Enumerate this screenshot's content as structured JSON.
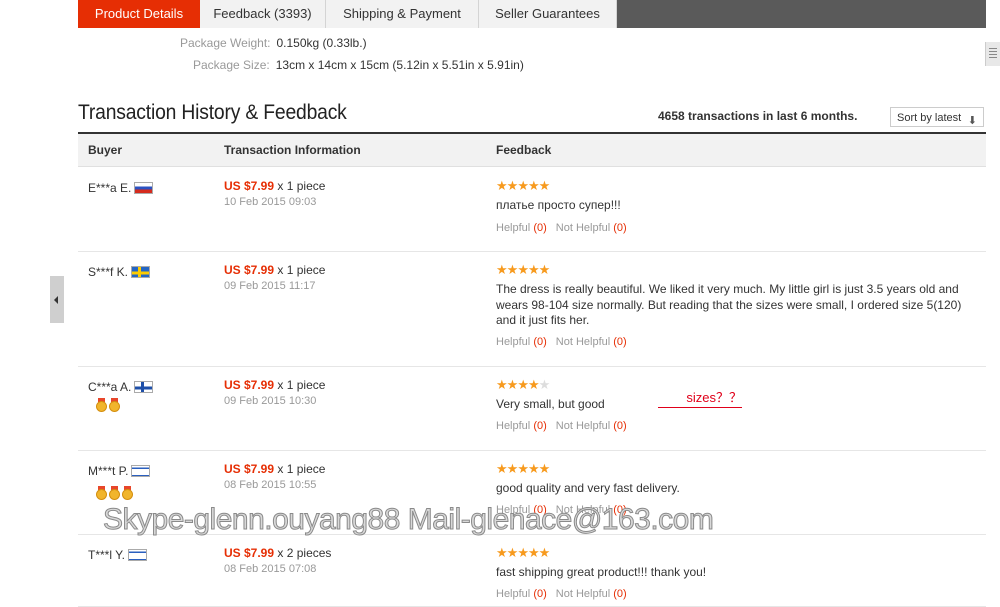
{
  "tabs": [
    {
      "label": "Product Details",
      "active": true
    },
    {
      "label": "Feedback (3393)",
      "active": false
    },
    {
      "label": "Shipping & Payment",
      "active": false
    },
    {
      "label": "Seller Guarantees",
      "active": false
    }
  ],
  "specs": {
    "weight_label": "Package Weight:",
    "weight_value": "0.150kg (0.33lb.)",
    "size_label": "Package Size:",
    "size_value": "13cm x 14cm x 15cm (5.12in x 5.51in x 5.91in)"
  },
  "section_title": "Transaction History & Feedback",
  "transactions_count": "4658 transactions in last 6 months.",
  "sort_label": "Sort by latest",
  "columns": {
    "buyer": "Buyer",
    "transaction": "Transaction Information",
    "feedback": "Feedback"
  },
  "helpful_label": "Helpful",
  "not_helpful_label": "Not Helpful",
  "colors": {
    "accent": "#e62e04",
    "star": "#f79a1e"
  },
  "rows": [
    {
      "buyer": "E***a E.",
      "flag": "ru",
      "medals": 0,
      "price": "US $7.99",
      "qty": " x 1 piece",
      "date": "10 Feb 2015 09:03",
      "stars": 5,
      "feedback": "платье просто супер!!!",
      "helpful": "(0)",
      "not_helpful": "(0)"
    },
    {
      "buyer": "S***f K.",
      "flag": "se",
      "medals": 0,
      "price": "US $7.99",
      "qty": " x 1 piece",
      "date": "09 Feb 2015 11:17",
      "stars": 5,
      "feedback": "The dress is really beautiful. We liked it very much. My little girl is just 3.5 years old and wears 98-104 size normally. But reading that the sizes were small, I ordered size 5(120) and it just fits her.",
      "helpful": "(0)",
      "not_helpful": "(0)"
    },
    {
      "buyer": "C***a A.",
      "flag": "fi",
      "medals": 2,
      "price": "US $7.99",
      "qty": " x 1 piece",
      "date": "09 Feb 2015 10:30",
      "stars": 4,
      "feedback": "Very small, but good",
      "helpful": "(0)",
      "not_helpful": "(0)"
    },
    {
      "buyer": "M***t P.",
      "flag": "il",
      "medals": 3,
      "price": "US $7.99",
      "qty": " x 1 piece",
      "date": "08 Feb 2015 10:55",
      "stars": 5,
      "feedback": "good quality and very fast delivery.",
      "helpful": "(0)",
      "not_helpful": "(0)"
    },
    {
      "buyer": "T***l Y.",
      "flag": "il",
      "medals": 0,
      "price": "US $7.99",
      "qty": " x 2 pieces",
      "date": "08 Feb 2015 07:08",
      "stars": 5,
      "feedback": "fast shipping great product!!! thank you!",
      "helpful": "(0)",
      "not_helpful": "(0)"
    }
  ],
  "annotation": "sizes？？",
  "watermark": "Skype-glenn.ouyang88 Mail-glenace@163.com"
}
